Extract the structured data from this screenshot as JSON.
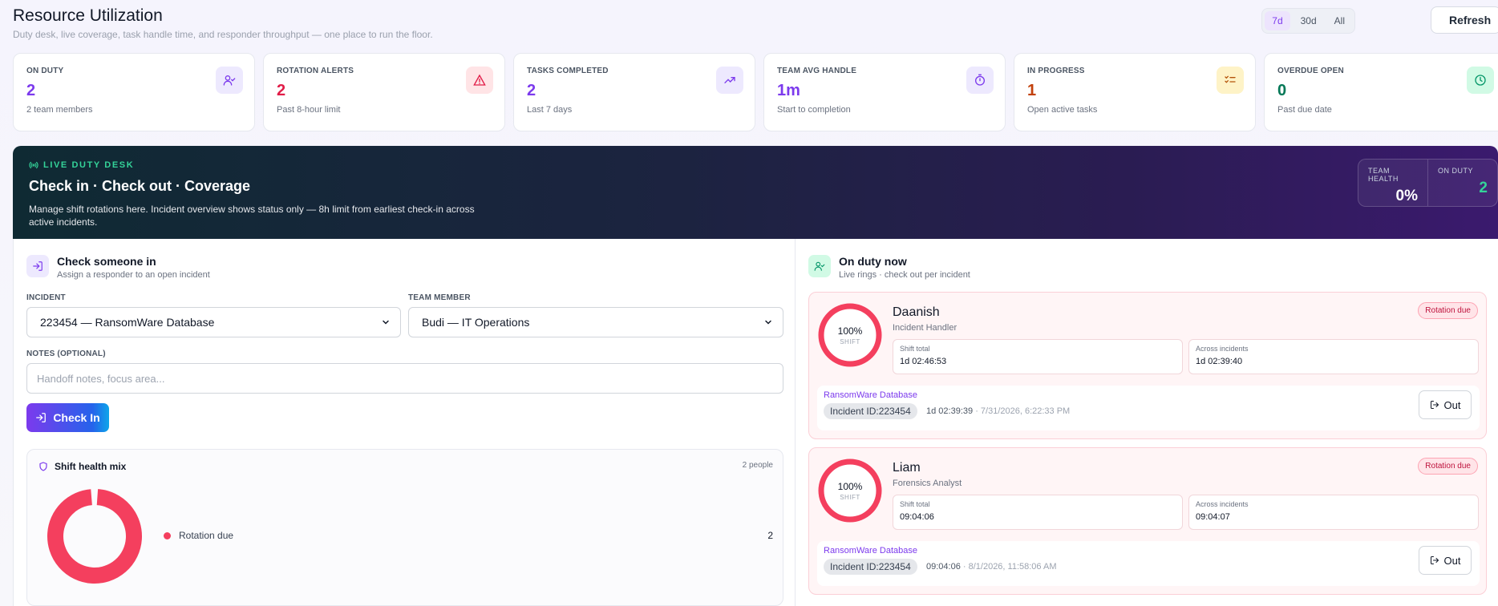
{
  "header": {
    "title": "Resource Utilization",
    "subtitle": "Duty desk, live coverage, task handle time, and responder throughput — one place to run the floor.",
    "ranges": [
      "7d",
      "30d",
      "All"
    ],
    "active_range": "7d",
    "refresh_label": "Refresh"
  },
  "kpis": [
    {
      "label": "ON DUTY",
      "value": "2",
      "sub": "2 team members",
      "icon": "user-check-icon",
      "color": "#7c3aed",
      "icon_bg": "#ede9fe"
    },
    {
      "label": "ROTATION ALERTS",
      "value": "2",
      "sub": "Past 8-hour limit",
      "icon": "alert-triangle-icon",
      "color": "#e11d48",
      "icon_bg": "#ffe4e6"
    },
    {
      "label": "TASKS COMPLETED",
      "value": "2",
      "sub": "Last 7 days",
      "icon": "trending-up-icon",
      "color": "#7c3aed",
      "icon_bg": "#ede9fe"
    },
    {
      "label": "TEAM AVG HANDLE",
      "value": "1m",
      "sub": "Start to completion",
      "icon": "timer-icon",
      "color": "#7c3aed",
      "icon_bg": "#ede9fe"
    },
    {
      "label": "IN PROGRESS",
      "value": "1",
      "sub": "Open active tasks",
      "icon": "list-checks-icon",
      "color": "#c2410c",
      "icon_bg": "#fef3c7"
    },
    {
      "label": "OVERDUE OPEN",
      "value": "0",
      "sub": "Past due date",
      "icon": "clock-icon",
      "color": "#047857",
      "icon_bg": "#d1fae5"
    }
  ],
  "banner": {
    "kicker": "LIVE DUTY DESK",
    "title": "Check in · Check out · Coverage",
    "description": "Manage shift rotations here. Incident overview shows status only — 8h limit from earliest check-in across active incidents.",
    "team_health_label": "TEAM HEALTH",
    "team_health_value": "0%",
    "on_duty_label": "ON DUTY",
    "on_duty_value": "2"
  },
  "checkin": {
    "title": "Check someone in",
    "subtitle": "Assign a responder to an open incident",
    "incident_label": "INCIDENT",
    "incident_value": "223454 — RansomWare Database",
    "member_label": "TEAM MEMBER",
    "member_value": "Budi — IT Operations",
    "notes_label": "NOTES (OPTIONAL)",
    "notes_placeholder": "Handoff notes, focus area...",
    "button_label": "Check In"
  },
  "mix": {
    "title": "Shift health mix",
    "count": "2 people",
    "legend": [
      {
        "label": "Rotation due",
        "value": "2",
        "color": "#f43f5e"
      }
    ]
  },
  "duty": {
    "title": "On duty now",
    "subtitle": "Live rings · check out per incident",
    "people": [
      {
        "name": "Daanish",
        "role": "Incident Handler",
        "pct": "100%",
        "ring_label": "SHIFT",
        "badge": "Rotation due",
        "shift_total_label": "Shift total",
        "shift_total": "1d 02:46:53",
        "across_label": "Across incidents",
        "across": "1d 02:39:40",
        "incident_name": "RansomWare Database",
        "incident_id": "Incident ID:223454",
        "incident_duration": "1d 02:39:39",
        "incident_time": "· 7/31/2026, 6:22:33 PM",
        "out_label": "Out"
      },
      {
        "name": "Liam",
        "role": "Forensics Analyst",
        "pct": "100%",
        "ring_label": "SHIFT",
        "badge": "Rotation due",
        "shift_total_label": "Shift total",
        "shift_total": "09:04:06",
        "across_label": "Across incidents",
        "across": "09:04:07",
        "incident_name": "RansomWare Database",
        "incident_id": "Incident ID:223454",
        "incident_duration": "09:04:06",
        "incident_time": "· 8/1/2026, 11:58:06 AM",
        "out_label": "Out"
      }
    ]
  }
}
